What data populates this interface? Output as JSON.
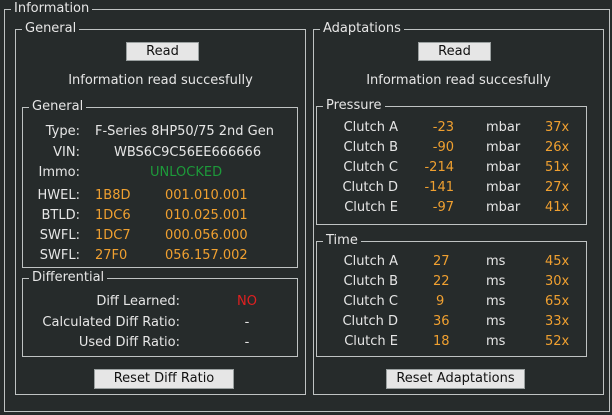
{
  "info_frame": {
    "title": "Information"
  },
  "general_panel": {
    "title": "General",
    "read_label": "Read",
    "status": "Information read succesfully",
    "general_box": {
      "title": "General",
      "type_label": "Type:",
      "type_value": "F-Series 8HP50/75 2nd Gen",
      "vin_label": "VIN:",
      "vin_value": "WBS6C9C56EE666666",
      "immo_label": "Immo:",
      "immo_value": "UNLOCKED",
      "rows": [
        {
          "label": "HWEL:",
          "id": "1B8D",
          "version": "001.010.001"
        },
        {
          "label": "BTLD:",
          "id": "1DC6",
          "version": "010.025.001"
        },
        {
          "label": "SWFL:",
          "id": "1DC7",
          "version": "000.056.000"
        },
        {
          "label": "SWFL:",
          "id": "27F0",
          "version": "056.157.002"
        }
      ]
    },
    "differential_box": {
      "title": "Differential",
      "learned_label": "Diff Learned:",
      "learned_value": "NO",
      "calc_label": "Calculated Diff Ratio:",
      "calc_value": "-",
      "used_label": "Used Diff Ratio:",
      "used_value": "-"
    },
    "reset_diff_label": "Reset Diff Ratio"
  },
  "adaptations_panel": {
    "title": "Adaptations",
    "read_label": "Read",
    "status": "Information read succesfully",
    "pressure_box": {
      "title": "Pressure",
      "rows": [
        {
          "name": "Clutch A",
          "value": "-23",
          "unit": "mbar",
          "count": "37x"
        },
        {
          "name": "Clutch B",
          "value": "-90",
          "unit": "mbar",
          "count": "26x"
        },
        {
          "name": "Clutch C",
          "value": "-214",
          "unit": "mbar",
          "count": "51x"
        },
        {
          "name": "Clutch D",
          "value": "-141",
          "unit": "mbar",
          "count": "27x"
        },
        {
          "name": "Clutch E",
          "value": "-97",
          "unit": "mbar",
          "count": "41x"
        }
      ]
    },
    "time_box": {
      "title": "Time",
      "rows": [
        {
          "name": "Clutch A",
          "value": "27",
          "unit": "ms",
          "count": "45x"
        },
        {
          "name": "Clutch B",
          "value": "22",
          "unit": "ms",
          "count": "30x"
        },
        {
          "name": "Clutch C",
          "value": "9",
          "unit": "ms",
          "count": "65x"
        },
        {
          "name": "Clutch D",
          "value": "36",
          "unit": "ms",
          "count": "33x"
        },
        {
          "name": "Clutch E",
          "value": "18",
          "unit": "ms",
          "count": "52x"
        }
      ]
    },
    "reset_adapt_label": "Reset Adaptations"
  }
}
